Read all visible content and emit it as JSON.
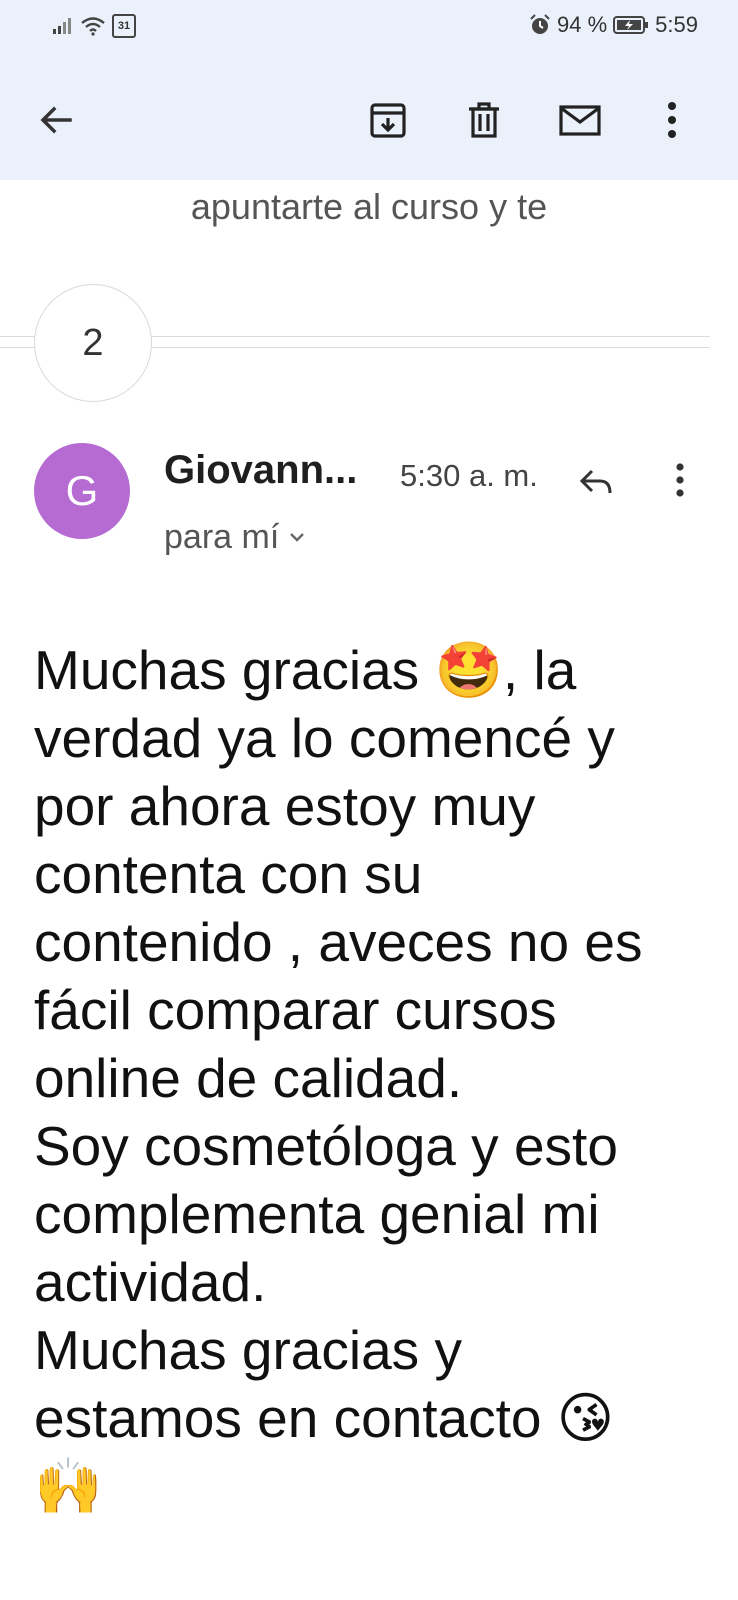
{
  "status_bar": {
    "calendar_badge": "31",
    "battery_percent": "94 %",
    "clock": "5:59"
  },
  "toolbar": {
    "icons": [
      "back-arrow-icon",
      "archive-icon",
      "delete-icon",
      "mark-unread-icon",
      "more-options-icon"
    ]
  },
  "thread": {
    "preview_text": "apuntarte al curso y te",
    "collapsed_count": "2"
  },
  "message": {
    "avatar_letter": "G",
    "avatar_color": "#b56bd2",
    "sender": "Giovann...",
    "time": "5:30 a. m.",
    "recipient": "para mí",
    "body": "Muchas gracias 🤩, la\nverdad ya lo comencé y\npor ahora estoy muy\ncontenta con su\ncontenido , aveces no es\nfácil comparar cursos\nonline de calidad.\nSoy cosmetóloga y esto\ncomplementa genial mi\nactividad.\nMuchas gracias y\nestamos en contacto 😘\n🙌"
  }
}
